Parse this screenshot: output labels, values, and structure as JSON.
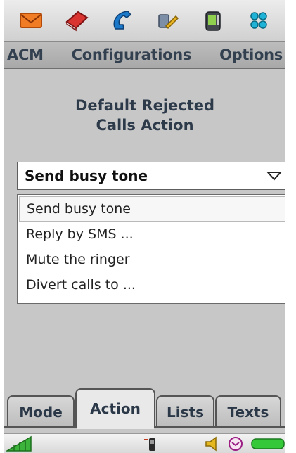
{
  "toolbar": {
    "icons": [
      "envelope-icon",
      "book-icon",
      "phone-handset-icon",
      "tools-icon",
      "phone-device-icon",
      "app-grid-icon"
    ]
  },
  "menu": {
    "acm": "ACM",
    "configurations": "Configurations",
    "options": "Options"
  },
  "heading": {
    "line1": "Default Rejected",
    "line2": "Calls Action"
  },
  "dropdown": {
    "selected": "Send busy tone",
    "options": [
      "Send busy tone",
      "Reply by SMS ...",
      "Mute the ringer",
      "Divert calls to ..."
    ]
  },
  "tabs": {
    "mode": "Mode",
    "action": "Action",
    "lists": "Lists",
    "texts": "Texts",
    "active": "Action"
  },
  "status": {
    "icons": [
      "signal-strength-icon",
      "phone-call-icon",
      "speaker-icon",
      "clock-icon",
      "battery-icon"
    ]
  },
  "colors": {
    "background": "#c7c7c7",
    "menu_text": "#33404f",
    "panel": "#ffffff",
    "battery": "#35c93a",
    "signal": "#3cb43c"
  }
}
